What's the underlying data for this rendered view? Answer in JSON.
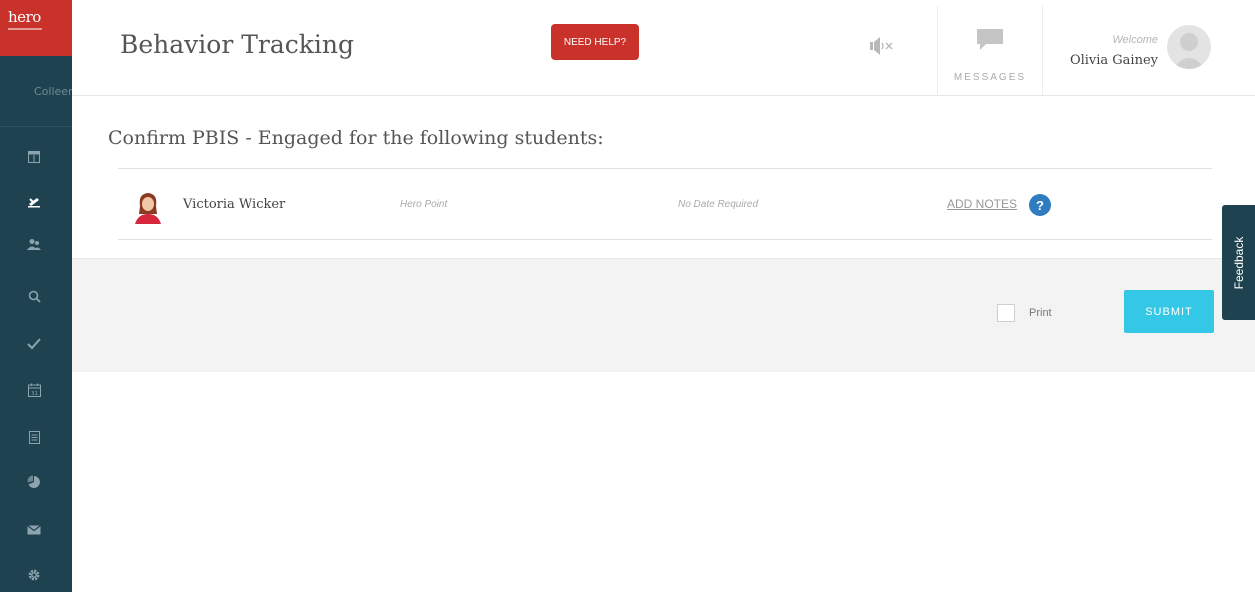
{
  "brand": {
    "logo_text": "hero",
    "accent": "#c8322b",
    "sidebar_bg": "#1f4250",
    "submit_color": "#35c7e6"
  },
  "sidebar": {
    "school_label": "Colleen",
    "items": [
      {
        "name": "dashboard",
        "icon": "dashboard-icon"
      },
      {
        "name": "behavior",
        "icon": "behavior-icon",
        "active": true
      },
      {
        "name": "students",
        "icon": "students-icon"
      },
      {
        "name": "search",
        "icon": "search-icon"
      },
      {
        "name": "check",
        "icon": "check-icon"
      },
      {
        "name": "calendar",
        "icon": "calendar-icon"
      },
      {
        "name": "reports",
        "icon": "document-icon"
      },
      {
        "name": "analytics",
        "icon": "pie-chart-icon"
      },
      {
        "name": "mail",
        "icon": "mail-icon"
      },
      {
        "name": "settings",
        "icon": "gear-icon"
      }
    ],
    "calendar_day": "31"
  },
  "header": {
    "title": "Behavior Tracking",
    "help_label": "NEED HELP?",
    "messages_label": "MESSAGES",
    "welcome": "Welcome",
    "user_name": "Olivia Gainey"
  },
  "main": {
    "section_title": "Confirm PBIS - Engaged for the following students:",
    "students": [
      {
        "name": "Victoria Wicker",
        "type": "Hero Point",
        "date": "No Date Required",
        "notes_label": "ADD NOTES",
        "help_glyph": "?"
      }
    ]
  },
  "footer": {
    "print_label": "Print",
    "print_checked": false,
    "submit_label": "SUBMIT"
  },
  "feedback_label": "Feedback"
}
